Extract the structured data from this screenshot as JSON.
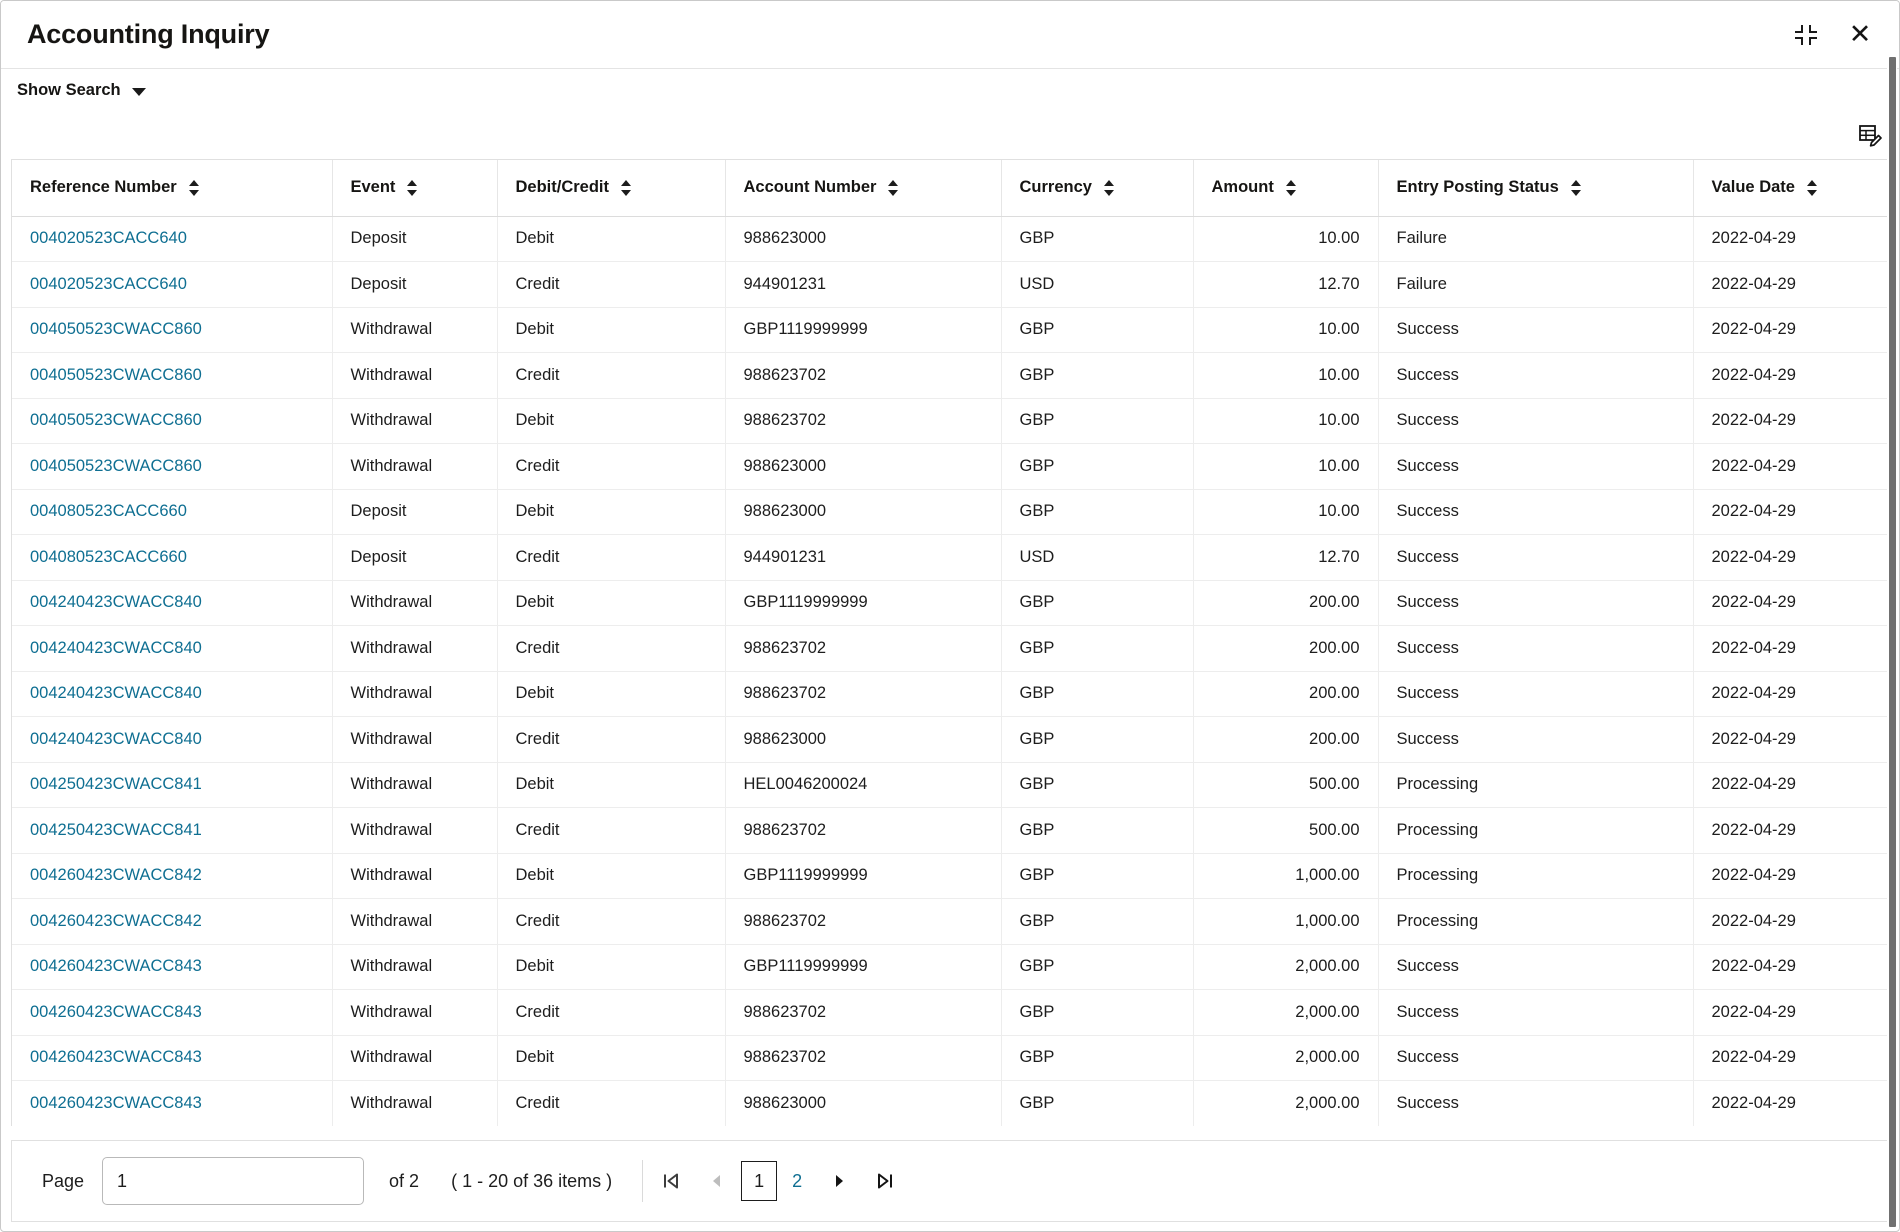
{
  "window": {
    "title": "Accounting Inquiry",
    "collapse_icon": "collapse-icon",
    "close_icon": "close-icon",
    "close_glyph": "✕"
  },
  "search": {
    "toggle_label": "Show Search",
    "caret_icon": "chevron-down-icon"
  },
  "toolbar": {
    "edit_columns_icon": "table-edit-icon"
  },
  "table": {
    "columns": [
      {
        "key": "reference_number",
        "label": "Reference Number",
        "sortable": true,
        "align": "left"
      },
      {
        "key": "event",
        "label": "Event",
        "sortable": true,
        "align": "left"
      },
      {
        "key": "debit_credit",
        "label": "Debit/Credit",
        "sortable": true,
        "align": "left"
      },
      {
        "key": "account_number",
        "label": "Account Number",
        "sortable": true,
        "align": "left"
      },
      {
        "key": "currency",
        "label": "Currency",
        "sortable": true,
        "align": "left"
      },
      {
        "key": "amount",
        "label": "Amount",
        "sortable": true,
        "align": "right"
      },
      {
        "key": "entry_posting_status",
        "label": "Entry Posting Status",
        "sortable": true,
        "align": "left"
      },
      {
        "key": "value_date",
        "label": "Value Date",
        "sortable": true,
        "align": "left"
      }
    ],
    "rows": [
      {
        "reference_number": "004020523CACC640",
        "event": "Deposit",
        "debit_credit": "Debit",
        "account_number": "988623000",
        "currency": "GBP",
        "amount": "10.00",
        "entry_posting_status": "Failure",
        "value_date": "2022-04-29"
      },
      {
        "reference_number": "004020523CACC640",
        "event": "Deposit",
        "debit_credit": "Credit",
        "account_number": "944901231",
        "currency": "USD",
        "amount": "12.70",
        "entry_posting_status": "Failure",
        "value_date": "2022-04-29"
      },
      {
        "reference_number": "004050523CWACC860",
        "event": "Withdrawal",
        "debit_credit": "Debit",
        "account_number": "GBP1119999999",
        "currency": "GBP",
        "amount": "10.00",
        "entry_posting_status": "Success",
        "value_date": "2022-04-29"
      },
      {
        "reference_number": "004050523CWACC860",
        "event": "Withdrawal",
        "debit_credit": "Credit",
        "account_number": "988623702",
        "currency": "GBP",
        "amount": "10.00",
        "entry_posting_status": "Success",
        "value_date": "2022-04-29"
      },
      {
        "reference_number": "004050523CWACC860",
        "event": "Withdrawal",
        "debit_credit": "Debit",
        "account_number": "988623702",
        "currency": "GBP",
        "amount": "10.00",
        "entry_posting_status": "Success",
        "value_date": "2022-04-29"
      },
      {
        "reference_number": "004050523CWACC860",
        "event": "Withdrawal",
        "debit_credit": "Credit",
        "account_number": "988623000",
        "currency": "GBP",
        "amount": "10.00",
        "entry_posting_status": "Success",
        "value_date": "2022-04-29"
      },
      {
        "reference_number": "004080523CACC660",
        "event": "Deposit",
        "debit_credit": "Debit",
        "account_number": "988623000",
        "currency": "GBP",
        "amount": "10.00",
        "entry_posting_status": "Success",
        "value_date": "2022-04-29"
      },
      {
        "reference_number": "004080523CACC660",
        "event": "Deposit",
        "debit_credit": "Credit",
        "account_number": "944901231",
        "currency": "USD",
        "amount": "12.70",
        "entry_posting_status": "Success",
        "value_date": "2022-04-29"
      },
      {
        "reference_number": "004240423CWACC840",
        "event": "Withdrawal",
        "debit_credit": "Debit",
        "account_number": "GBP1119999999",
        "currency": "GBP",
        "amount": "200.00",
        "entry_posting_status": "Success",
        "value_date": "2022-04-29"
      },
      {
        "reference_number": "004240423CWACC840",
        "event": "Withdrawal",
        "debit_credit": "Credit",
        "account_number": "988623702",
        "currency": "GBP",
        "amount": "200.00",
        "entry_posting_status": "Success",
        "value_date": "2022-04-29"
      },
      {
        "reference_number": "004240423CWACC840",
        "event": "Withdrawal",
        "debit_credit": "Debit",
        "account_number": "988623702",
        "currency": "GBP",
        "amount": "200.00",
        "entry_posting_status": "Success",
        "value_date": "2022-04-29"
      },
      {
        "reference_number": "004240423CWACC840",
        "event": "Withdrawal",
        "debit_credit": "Credit",
        "account_number": "988623000",
        "currency": "GBP",
        "amount": "200.00",
        "entry_posting_status": "Success",
        "value_date": "2022-04-29"
      },
      {
        "reference_number": "004250423CWACC841",
        "event": "Withdrawal",
        "debit_credit": "Debit",
        "account_number": "HEL0046200024",
        "currency": "GBP",
        "amount": "500.00",
        "entry_posting_status": "Processing",
        "value_date": "2022-04-29"
      },
      {
        "reference_number": "004250423CWACC841",
        "event": "Withdrawal",
        "debit_credit": "Credit",
        "account_number": "988623702",
        "currency": "GBP",
        "amount": "500.00",
        "entry_posting_status": "Processing",
        "value_date": "2022-04-29"
      },
      {
        "reference_number": "004260423CWACC842",
        "event": "Withdrawal",
        "debit_credit": "Debit",
        "account_number": "GBP1119999999",
        "currency": "GBP",
        "amount": "1,000.00",
        "entry_posting_status": "Processing",
        "value_date": "2022-04-29"
      },
      {
        "reference_number": "004260423CWACC842",
        "event": "Withdrawal",
        "debit_credit": "Credit",
        "account_number": "988623702",
        "currency": "GBP",
        "amount": "1,000.00",
        "entry_posting_status": "Processing",
        "value_date": "2022-04-29"
      },
      {
        "reference_number": "004260423CWACC843",
        "event": "Withdrawal",
        "debit_credit": "Debit",
        "account_number": "GBP1119999999",
        "currency": "GBP",
        "amount": "2,000.00",
        "entry_posting_status": "Success",
        "value_date": "2022-04-29"
      },
      {
        "reference_number": "004260423CWACC843",
        "event": "Withdrawal",
        "debit_credit": "Credit",
        "account_number": "988623702",
        "currency": "GBP",
        "amount": "2,000.00",
        "entry_posting_status": "Success",
        "value_date": "2022-04-29"
      },
      {
        "reference_number": "004260423CWACC843",
        "event": "Withdrawal",
        "debit_credit": "Debit",
        "account_number": "988623702",
        "currency": "GBP",
        "amount": "2,000.00",
        "entry_posting_status": "Success",
        "value_date": "2022-04-29"
      },
      {
        "reference_number": "004260423CWACC843",
        "event": "Withdrawal",
        "debit_credit": "Credit",
        "account_number": "988623000",
        "currency": "GBP",
        "amount": "2,000.00",
        "entry_posting_status": "Success",
        "value_date": "2022-04-29"
      }
    ]
  },
  "pagination": {
    "page_label": "Page",
    "page_value": "1",
    "of_text": "of 2",
    "range_text": "( 1 - 20 of 36 items )",
    "pages": [
      {
        "label": "1",
        "active": true
      },
      {
        "label": "2",
        "active": false
      }
    ],
    "first_icon": "first-page-icon",
    "prev_icon": "previous-page-icon",
    "next_icon": "next-page-icon",
    "last_icon": "last-page-icon",
    "prev_disabled": true,
    "next_disabled": false
  },
  "colors": {
    "link": "#0f6f92",
    "text": "#1d1d1d",
    "border": "#e0e0e0"
  }
}
